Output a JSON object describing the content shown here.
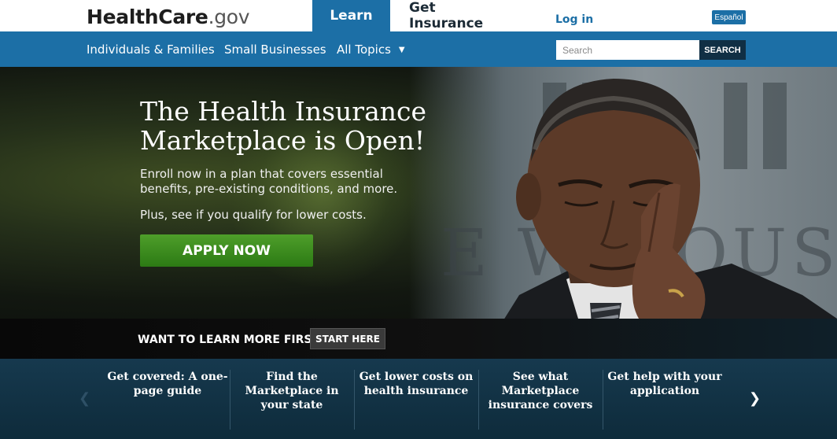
{
  "header": {
    "logo_brand": "HealthCare",
    "logo_tld": ".gov",
    "tabs": [
      {
        "label": "Learn",
        "active": true
      },
      {
        "label": "Get Insurance",
        "active": false
      }
    ],
    "login_label": "Log in",
    "language_label": "Español"
  },
  "nav": {
    "items": [
      {
        "label": "Individuals & Families"
      },
      {
        "label": "Small Businesses"
      },
      {
        "label": "All Topics",
        "has_dropdown": true
      }
    ],
    "search": {
      "placeholder": "Search",
      "value": "",
      "button_label": "SEARCH"
    }
  },
  "hero": {
    "title": "The Health Insurance Marketplace is Open!",
    "subtitle": "Enroll now in a plan that covers essential benefits, pre-existing conditions, and more.",
    "subtitle2": "Plus, see if you qualify for lower costs.",
    "cta_label": "APPLY NOW",
    "background_text": "E W  HOUS"
  },
  "learn_more": {
    "prompt": "WANT TO LEARN MORE FIRST?",
    "button_label": "START HERE"
  },
  "carousel": {
    "items": [
      {
        "label": "Get covered: A one-page guide"
      },
      {
        "label": "Find the Marketplace in your state"
      },
      {
        "label": "Get lower costs on health insurance"
      },
      {
        "label": "See what Marketplace insurance covers"
      },
      {
        "label": "Get help with your application"
      }
    ],
    "prev_icon": "chevron-left-icon",
    "next_icon": "chevron-right-icon"
  },
  "colors": {
    "primary_blue": "#1c6fa6",
    "dark_navy": "#102f44",
    "cta_green": "#3a8c1f",
    "hero_dark": "#0e0e0e",
    "bottom_bar": "#0e2b3b"
  }
}
